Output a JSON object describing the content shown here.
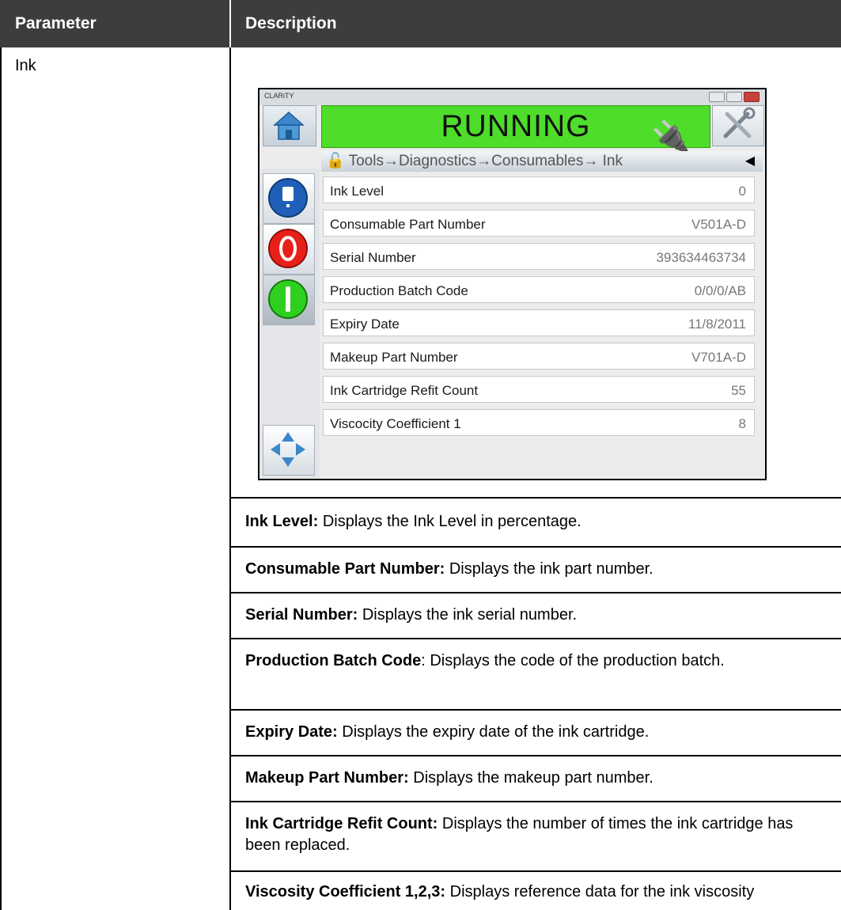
{
  "table": {
    "headers": {
      "parameter": "Parameter",
      "description": "Description"
    },
    "parameter": "Ink",
    "descriptions": [
      {
        "term": "Ink Level:",
        "text": " Displays the Ink Level in percentage."
      },
      {
        "term": "Consumable Part Number:",
        "text": " Displays the ink part number."
      },
      {
        "term": "Serial Number:",
        "text": " Displays the ink serial number."
      },
      {
        "term": "Production Batch Code",
        "text": ": Displays the code of the production batch."
      },
      {
        "term": "Expiry Date:",
        "text": " Displays the expiry date of the ink cartridge."
      },
      {
        "term": "Makeup Part Number:",
        "text": " Displays the makeup part number."
      },
      {
        "term": "Ink Cartridge Refit Count:",
        "text": " Displays the number of times the ink cartridge has been replaced."
      },
      {
        "term": "Viscosity Coefficient 1,2,3:",
        "text": " Displays reference data for the ink viscosity"
      }
    ]
  },
  "device": {
    "logo": "CLARiTY",
    "status": "RUNNING",
    "breadcrumb": "Tools→Diagnostics→Consumables→ Ink",
    "rows": [
      {
        "label": "Ink Level",
        "value": "0"
      },
      {
        "label": "Consumable Part Number",
        "value": "V501A-D"
      },
      {
        "label": "Serial Number",
        "value": "393634463734"
      },
      {
        "label": "Production Batch Code",
        "value": "0/0/0/AB"
      },
      {
        "label": "Expiry Date",
        "value": "11/8/2011"
      },
      {
        "label": "Makeup Part Number",
        "value": "V701A-D"
      },
      {
        "label": "Ink Cartridge Refit Count",
        "value": "55"
      },
      {
        "label": "Viscocity Coefficient 1",
        "value": "8"
      }
    ],
    "icons": {
      "home": "home-icon",
      "tools": "tools-icon",
      "pin": "printhead-icon",
      "lock": "lock-icon",
      "back": "back-arrow-icon",
      "status_info": "info-icon",
      "stop": "stop-icon",
      "start": "start-icon",
      "nav": "navigation-arrows-icon"
    },
    "colors": {
      "running": "#4ddd2a",
      "stop": "#e8201a",
      "start": "#2fcf20",
      "info": "#1f5fb8"
    }
  }
}
